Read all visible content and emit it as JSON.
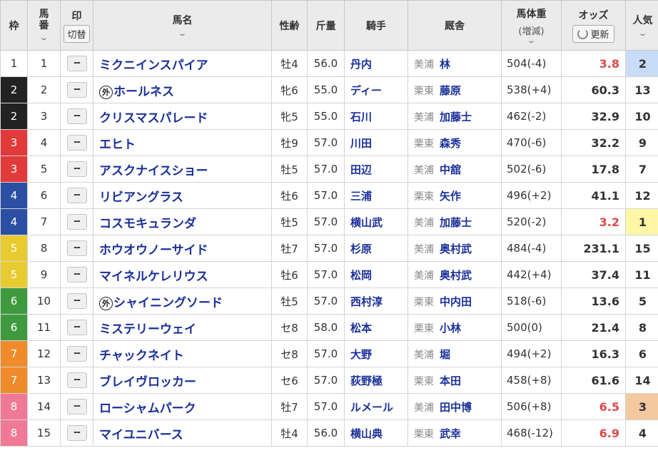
{
  "colors": {
    "waku": {
      "1": "#ffffff",
      "2": "#222222",
      "3": "#e23a3a",
      "4": "#2b4fa3",
      "5": "#e8cc2f",
      "6": "#3f9a3f",
      "7": "#ef8b2a",
      "8": "#f07a95"
    },
    "waku_text": {
      "1": "#333333",
      "2": "#ffffff",
      "3": "#ffffff",
      "4": "#ffffff",
      "5": "#ffffff",
      "6": "#ffffff",
      "7": "#ffffff",
      "8": "#ffffff"
    },
    "odds_popular": "#e04848",
    "odds_normal": "#333333",
    "pop_first": "#fdf7a6",
    "pop_second": "#c8dcf7",
    "pop_third": "#f5c9a0"
  },
  "headers": {
    "waku": "枠",
    "umaban": "馬番",
    "mark": "印",
    "mark_toggle": "切替",
    "horse_name": "馬名",
    "sex_age": "性齢",
    "kinryo": "斤量",
    "jockey": "騎手",
    "trainer": "厩舎",
    "weight": "馬体重",
    "weight_sub": "(増減)",
    "odds": "オッズ",
    "refresh": "更新",
    "popularity": "人気"
  },
  "gai_label": "外",
  "mark_placeholder": "--",
  "rows": [
    {
      "waku": "1",
      "umaban": "1",
      "name": "ミクニインスパイア",
      "gai": false,
      "sex_age": "牡4",
      "kinryo": "56.0",
      "jockey": "丹内",
      "region": "美浦",
      "trainer": "林",
      "weight": "504(-4)",
      "odds": "3.8",
      "pop": "2"
    },
    {
      "waku": "2",
      "umaban": "2",
      "name": "ホールネス",
      "gai": true,
      "sex_age": "牝6",
      "kinryo": "55.0",
      "jockey": "ディー",
      "region": "栗東",
      "trainer": "藤原",
      "weight": "538(+4)",
      "odds": "60.3",
      "pop": "13"
    },
    {
      "waku": "2",
      "umaban": "3",
      "name": "クリスマスパレード",
      "gai": false,
      "sex_age": "牝5",
      "kinryo": "55.0",
      "jockey": "石川",
      "region": "美浦",
      "trainer": "加藤士",
      "weight": "462(-2)",
      "odds": "32.9",
      "pop": "10"
    },
    {
      "waku": "3",
      "umaban": "4",
      "name": "エヒト",
      "gai": false,
      "sex_age": "牡9",
      "kinryo": "57.0",
      "jockey": "川田",
      "region": "栗東",
      "trainer": "森秀",
      "weight": "470(-6)",
      "odds": "32.2",
      "pop": "9"
    },
    {
      "waku": "3",
      "umaban": "5",
      "name": "アスクナイスショー",
      "gai": false,
      "sex_age": "牡5",
      "kinryo": "57.0",
      "jockey": "田辺",
      "region": "美浦",
      "trainer": "中舘",
      "weight": "502(-6)",
      "odds": "17.8",
      "pop": "7"
    },
    {
      "waku": "4",
      "umaban": "6",
      "name": "リビアングラス",
      "gai": false,
      "sex_age": "牡6",
      "kinryo": "57.0",
      "jockey": "三浦",
      "region": "栗東",
      "trainer": "矢作",
      "weight": "496(+2)",
      "odds": "41.1",
      "pop": "12"
    },
    {
      "waku": "4",
      "umaban": "7",
      "name": "コスモキュランダ",
      "gai": false,
      "sex_age": "牡5",
      "kinryo": "57.0",
      "jockey": "横山武",
      "region": "美浦",
      "trainer": "加藤士",
      "weight": "520(-2)",
      "odds": "3.2",
      "pop": "1"
    },
    {
      "waku": "5",
      "umaban": "8",
      "name": "ホウオウノーサイド",
      "gai": false,
      "sex_age": "牡7",
      "kinryo": "57.0",
      "jockey": "杉原",
      "region": "美浦",
      "trainer": "奥村武",
      "weight": "484(-4)",
      "odds": "231.1",
      "pop": "15"
    },
    {
      "waku": "5",
      "umaban": "9",
      "name": "マイネルケレリウス",
      "gai": false,
      "sex_age": "牡6",
      "kinryo": "57.0",
      "jockey": "松岡",
      "region": "美浦",
      "trainer": "奥村武",
      "weight": "442(+4)",
      "odds": "37.4",
      "pop": "11"
    },
    {
      "waku": "6",
      "umaban": "10",
      "name": "シャイニングソード",
      "gai": true,
      "sex_age": "牡5",
      "kinryo": "57.0",
      "jockey": "西村淳",
      "region": "栗東",
      "trainer": "中内田",
      "weight": "518(-6)",
      "odds": "13.6",
      "pop": "5"
    },
    {
      "waku": "6",
      "umaban": "11",
      "name": "ミステリーウェイ",
      "gai": false,
      "sex_age": "セ8",
      "kinryo": "58.0",
      "jockey": "松本",
      "region": "栗東",
      "trainer": "小林",
      "weight": "500(0)",
      "odds": "21.4",
      "pop": "8"
    },
    {
      "waku": "7",
      "umaban": "12",
      "name": "チャックネイト",
      "gai": false,
      "sex_age": "セ8",
      "kinryo": "57.0",
      "jockey": "大野",
      "region": "美浦",
      "trainer": "堀",
      "weight": "494(+2)",
      "odds": "16.3",
      "pop": "6"
    },
    {
      "waku": "7",
      "umaban": "13",
      "name": "ブレイヴロッカー",
      "gai": false,
      "sex_age": "セ6",
      "kinryo": "57.0",
      "jockey": "荻野極",
      "region": "栗東",
      "trainer": "本田",
      "weight": "458(+8)",
      "odds": "61.6",
      "pop": "14"
    },
    {
      "waku": "8",
      "umaban": "14",
      "name": "ローシャムパーク",
      "gai": false,
      "sex_age": "牡7",
      "kinryo": "57.0",
      "jockey": "ルメール",
      "region": "美浦",
      "trainer": "田中博",
      "weight": "506(+8)",
      "odds": "6.5",
      "pop": "3"
    },
    {
      "waku": "8",
      "umaban": "15",
      "name": "マイユニバース",
      "gai": false,
      "sex_age": "牡4",
      "kinryo": "56.0",
      "jockey": "横山典",
      "region": "栗東",
      "trainer": "武幸",
      "weight": "468(-12)",
      "odds": "6.9",
      "pop": "4"
    }
  ]
}
